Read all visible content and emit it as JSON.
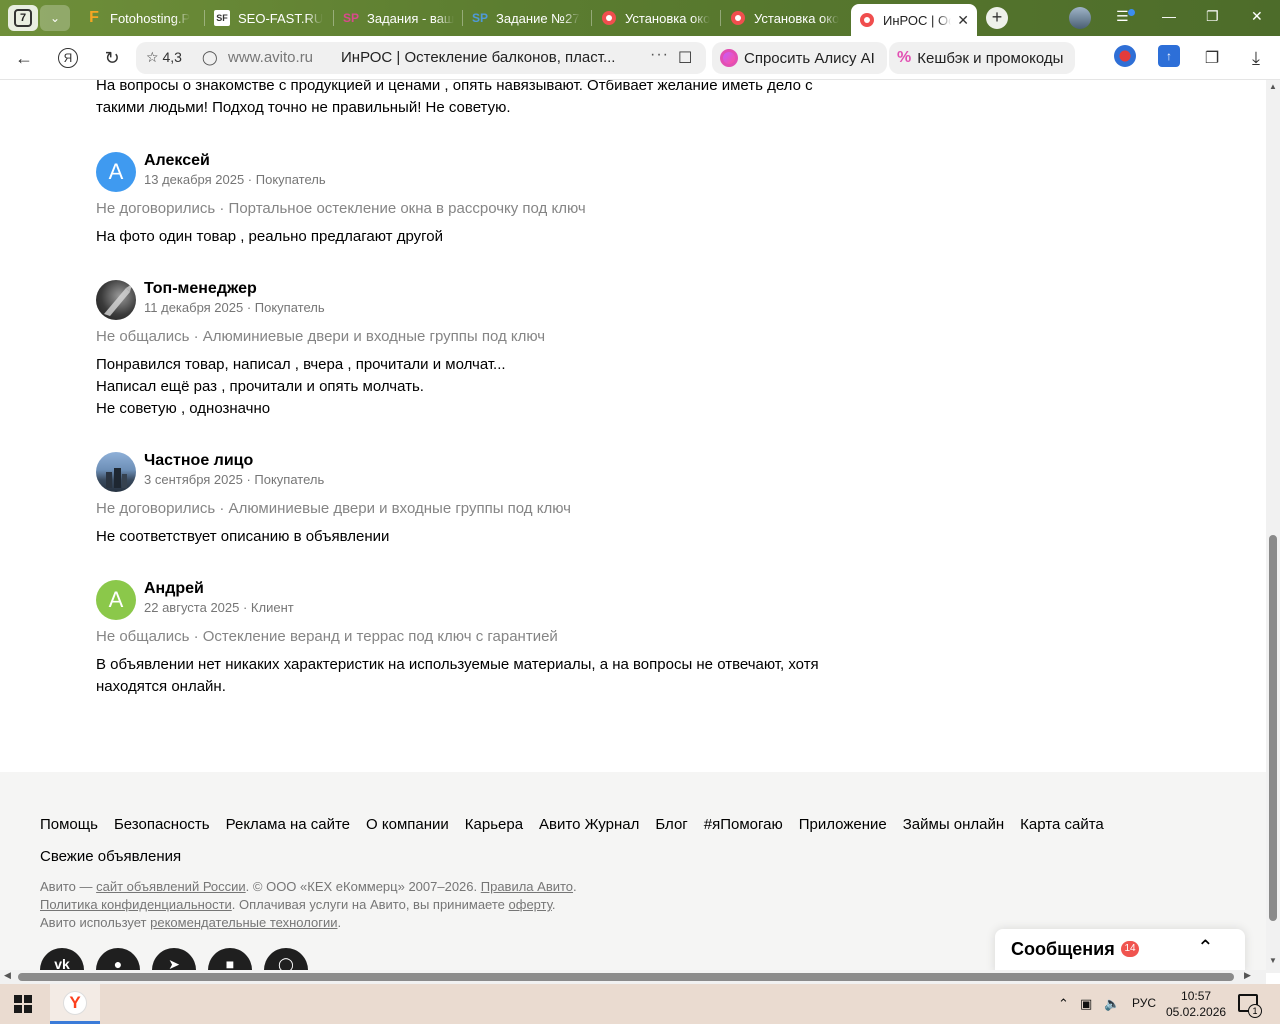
{
  "browser": {
    "tab_count": "7",
    "tabs": [
      {
        "title": "Fotohosting.P",
        "favicon": "F"
      },
      {
        "title": "SEO-FAST.RU",
        "favicon": "SF"
      },
      {
        "title": "Задания - ваш",
        "favicon": "SP"
      },
      {
        "title": "Задание №27",
        "favicon": "SP"
      },
      {
        "title": "Установка око",
        "favicon": "avito"
      },
      {
        "title": "Установка око",
        "favicon": "avito"
      },
      {
        "title": "ИнРОС | Ос",
        "favicon": "avito",
        "active": true
      }
    ],
    "address": {
      "rating": "4,3",
      "domain": "www.avito.ru",
      "page_title": "ИнРОС | Остекление балконов, пласт...",
      "dots": "···"
    },
    "alice_label": "Спросить Алису AI",
    "cashback_label": "Кешбэк и промокоды"
  },
  "reviews": {
    "previous_tail": "На вопросы о знакомстве с продукцией и ценами , опять навязывают. Отбивает желание иметь дело с такими людьми! Подход точно не правильный! Не советую.",
    "items": [
      {
        "avatar_letter": "А",
        "name": "Алексей",
        "meta": "13 декабря 2025 · Покупатель",
        "deal": "Не договорились · Портальное остекление окна в рассрочку под ключ",
        "text": "На фото один товар , реально предлагают другой"
      },
      {
        "avatar_letter": "",
        "name": "Топ-менеджер",
        "meta": "11 декабря 2025 · Покупатель",
        "deal": "Не общались · Алюминиевые двери и входные группы под ключ",
        "text_lines": [
          "Понравился товар, написал , вчера , прочитали и молчат...",
          "Написал ещё раз , прочитали и опять молчать.",
          "Не советую , однозначно"
        ]
      },
      {
        "avatar_letter": "",
        "name": "Частное лицо",
        "meta": "3 сентября 2025 · Покупатель",
        "deal": "Не договорились · Алюминиевые двери и входные группы под ключ",
        "text": "Не соответствует описанию в объявлении"
      },
      {
        "avatar_letter": "А",
        "name": "Андрей",
        "meta": "22 августа 2025 · Клиент",
        "deal": "Не общались · Остекление веранд и террас под ключ с гарантией",
        "text": "В объявлении нет никаких характеристик на используемые материалы, а на вопросы не отвечают, хотя находятся онлайн."
      }
    ]
  },
  "footer": {
    "links": [
      "Помощь",
      "Безопасность",
      "Реклама на сайте",
      "О компании",
      "Карьера",
      "Авито Журнал",
      "Блог",
      "#яПомогаю",
      "Приложение",
      "Займы онлайн",
      "Карта сайта",
      "Свежие объявления"
    ],
    "legal": {
      "l1_a": "Авито — ",
      "l1_link1": "сайт объявлений России",
      "l1_b": ". © ООО «КЕХ еКоммерц» 2007–2026. ",
      "l1_link2": "Правила Авито",
      "l1_c": ".",
      "l2_link1": "Политика конфиденциальности",
      "l2_a": ". Оплачивая услуги на Авито, вы принимаете ",
      "l2_link2": "оферту",
      "l2_b": ".",
      "l3_a": "Авито использует ",
      "l3_link": "рекомендательные технологии",
      "l3_b": "."
    }
  },
  "messages": {
    "label": "Сообщения",
    "count": "14"
  },
  "taskbar": {
    "language": "РУС",
    "time": "10:57",
    "date": "05.02.2026",
    "notifications": "1"
  },
  "colors": {
    "tabstrip": "#5d7e2c",
    "avatar_blue": "#3f9af0",
    "avatar_green": "#8bc84a",
    "badge": "#f0544f",
    "avito_favicon": "#f04e4e"
  }
}
